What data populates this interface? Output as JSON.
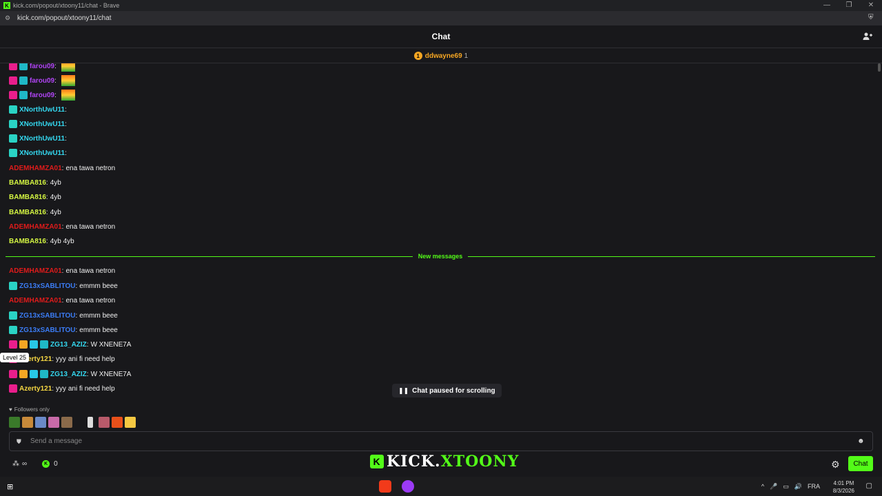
{
  "window": {
    "title": "kick.com/popout/xtoony11/chat - Brave",
    "url": "kick.com/popout/xtoony11/chat"
  },
  "chat": {
    "header_title": "Chat",
    "pinned_gifter": {
      "name": "ddwayne69",
      "count": "1"
    },
    "new_messages_label": "New messages",
    "tooltip": "Level 25",
    "paused_label": "Chat paused for scrolling",
    "followers_only": "Followers only",
    "input_placeholder": "Send a message",
    "points_value": "0",
    "send_button": "Chat",
    "overlay_logo_a": "KICK.",
    "overlay_logo_b": "XTOONY"
  },
  "messages": [
    {
      "user": "farou09",
      "color": "#b044f5",
      "text": "",
      "badges": [
        "b-pink",
        "b-blue"
      ],
      "emote": true
    },
    {
      "user": "farou09",
      "color": "#b044f5",
      "text": "",
      "badges": [
        "b-pink",
        "b-blue"
      ],
      "emote": true
    },
    {
      "user": "farou09",
      "color": "#b044f5",
      "text": "",
      "badges": [
        "b-pink",
        "b-blue"
      ],
      "emote": true
    },
    {
      "user": "XNorthUwU11",
      "color": "#34d8f0",
      "text": "",
      "badges": [
        "b-teal"
      ]
    },
    {
      "user": "XNorthUwU11",
      "color": "#34d8f0",
      "text": "",
      "badges": [
        "b-teal"
      ]
    },
    {
      "user": "XNorthUwU11",
      "color": "#34d8f0",
      "text": "",
      "badges": [
        "b-teal"
      ]
    },
    {
      "user": "XNorthUwU11",
      "color": "#34d8f0",
      "text": "",
      "badges": [
        "b-teal"
      ]
    },
    {
      "user": "ADEMHAMZA01",
      "color": "#e01b1b",
      "text": "ena tawa netron",
      "badges": []
    },
    {
      "user": "BAMBA816",
      "color": "#d4f542",
      "text": "4yb",
      "badges": []
    },
    {
      "user": "BAMBA816",
      "color": "#d4f542",
      "text": "4yb",
      "badges": []
    },
    {
      "user": "BAMBA816",
      "color": "#d4f542",
      "text": "4yb",
      "badges": []
    },
    {
      "user": "ADEMHAMZA01",
      "color": "#e01b1b",
      "text": "ena tawa netron",
      "badges": []
    },
    {
      "user": "BAMBA816",
      "color": "#d4f542",
      "text": "4yb 4yb",
      "badges": []
    },
    {
      "user": "ADEMHAMZA01",
      "color": "#e01b1b",
      "text": "ena tawa netron",
      "badges": []
    },
    {
      "user": "ZG13xSABLITOU",
      "color": "#3b7cf5",
      "text": "emmm beee",
      "badges": [
        "b-teal"
      ]
    },
    {
      "user": "ADEMHAMZA01",
      "color": "#e01b1b",
      "text": "ena tawa netron",
      "badges": []
    },
    {
      "user": "ZG13xSABLITOU",
      "color": "#3b7cf5",
      "text": "emmm beee",
      "badges": [
        "b-teal"
      ]
    },
    {
      "user": "ZG13xSABLITOU",
      "color": "#3b7cf5",
      "text": "emmm beee",
      "badges": [
        "b-teal"
      ]
    },
    {
      "user": "ZG13_AZIZ",
      "color": "#34d8f0",
      "text": "W XNENE7A",
      "badges": [
        "b-pink",
        "b-gold",
        "b-cyan",
        "b-blue"
      ]
    },
    {
      "user": "Azerty121",
      "color": "#f5d742",
      "text": "yyy ani fi need help",
      "badges": [
        "b-pink"
      ]
    },
    {
      "user": "ZG13_AZIZ",
      "color": "#34d8f0",
      "text": "W XNENE7A",
      "badges": [
        "b-pink",
        "b-gold",
        "b-cyan",
        "b-blue"
      ]
    },
    {
      "user": "Azerty121",
      "color": "#f5d742",
      "text": "yyy ani fi need help",
      "badges": [
        "b-pink"
      ]
    }
  ],
  "taskbar": {
    "lang": "FRA",
    "time": "4:01 PM",
    "date": "8/3/2026"
  },
  "colors": {
    "accent": "#53fc18",
    "bg": "#18181b"
  }
}
